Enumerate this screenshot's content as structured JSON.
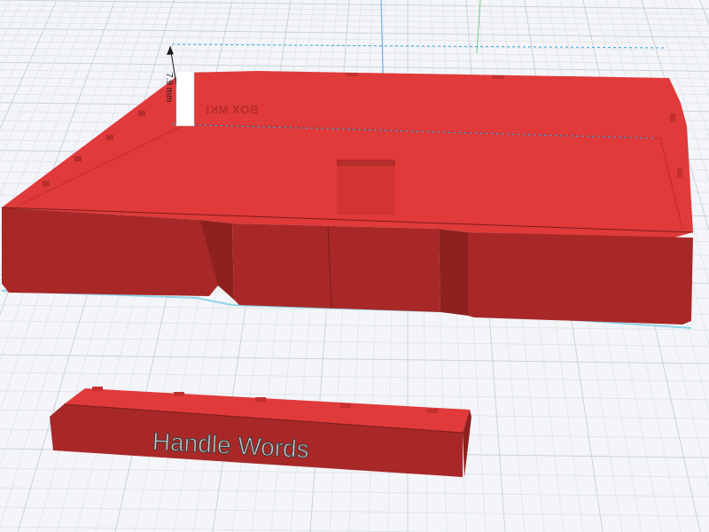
{
  "viewport": {
    "dimension_label": "7.9 mm",
    "box_engraving": "BOX MKI",
    "handle_text": "Handle Words"
  },
  "colors": {
    "background": "#f3f5f8",
    "grid_minor": "#e3e6ea",
    "grid_major": "#cdd2d8",
    "axis_y": "#5aa7f0",
    "axis_x": "#6fd08c",
    "part_top": "#e03a3a",
    "part_side": "#a82828",
    "part_shadow": "#8f2020",
    "selection": "#8fd3e8"
  }
}
